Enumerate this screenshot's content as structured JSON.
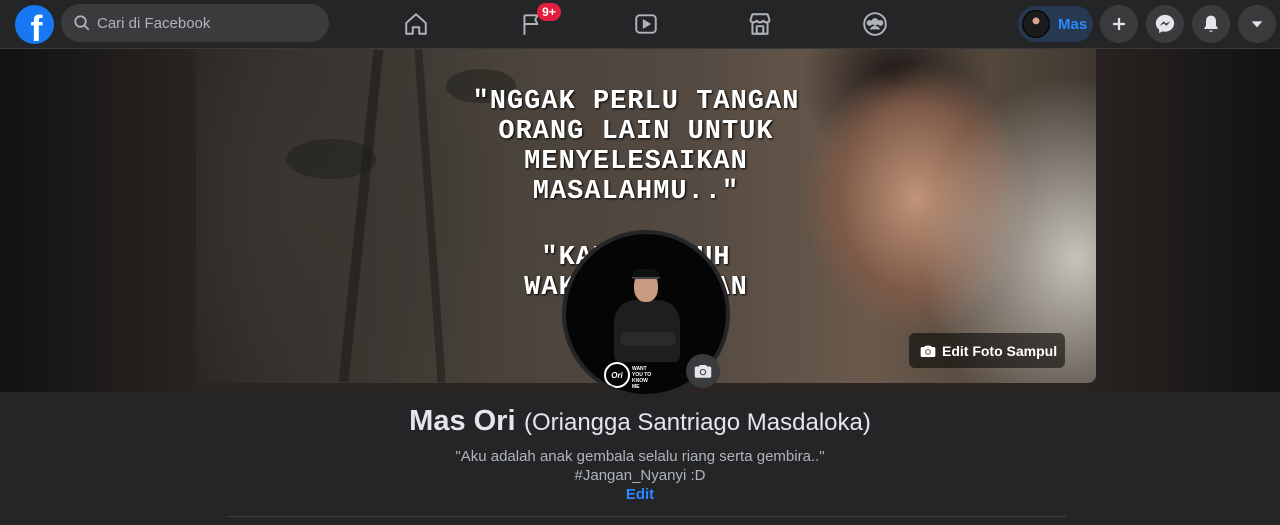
{
  "topbar": {
    "logo_letter": "f",
    "search_placeholder": "Cari di Facebook",
    "nav": {
      "home_icon": "home-icon",
      "watch_flag_icon": "flag-icon",
      "notification_badge": "9+",
      "video_icon": "play-icon",
      "marketplace_icon": "store-icon",
      "groups_icon": "groups-icon"
    },
    "profile_chip_name": "Mas",
    "actions": [
      "plus-icon",
      "messenger-icon",
      "bell-icon",
      "caret-down-icon"
    ]
  },
  "cover": {
    "quote_part1": "\"NGGAK PERLU TANGAN\nORANG LAIN UNTUK\nMENYELESAIKAN\nMASALAHMU..\"",
    "quote_part2": "\"KAMU     BUTUH\nWAKTU,        G, DAN\nBE              \"",
    "edit_button_label": "Edit Foto Sampul"
  },
  "profile": {
    "avatar_logo_text": "Ori",
    "avatar_tag_text": "WANT\nYOU TO\nKNOW ME",
    "name": "Mas Ori",
    "alternate_name": "(Oriangga Santriago Masdaloka)",
    "bio_line1": "\"Aku adalah anak gembala selalu riang serta gembira..\"",
    "bio_line2": "#Jangan_Nyanyi :D",
    "edit_label": "Edit"
  },
  "colors": {
    "brand_blue": "#1877f2",
    "link_blue": "#2d88ff",
    "badge_red": "#e41e3f",
    "bar_bg": "#242526",
    "page_bg": "#18191a"
  }
}
